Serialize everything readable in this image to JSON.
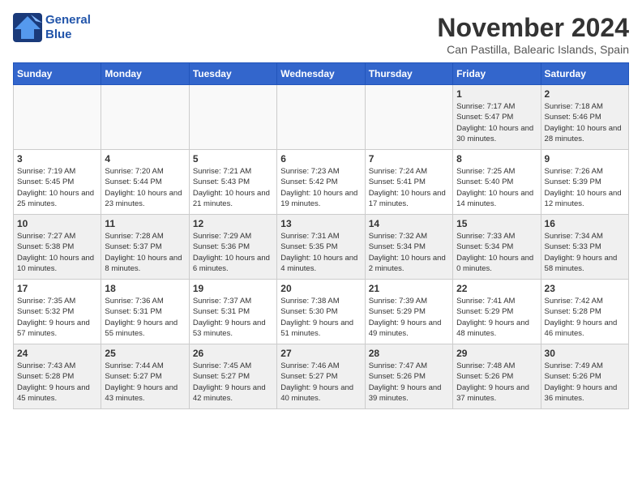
{
  "header": {
    "logo_line1": "General",
    "logo_line2": "Blue",
    "month_title": "November 2024",
    "location": "Can Pastilla, Balearic Islands, Spain"
  },
  "days_of_week": [
    "Sunday",
    "Monday",
    "Tuesday",
    "Wednesday",
    "Thursday",
    "Friday",
    "Saturday"
  ],
  "weeks": [
    [
      {
        "day": "",
        "info": "",
        "empty": true
      },
      {
        "day": "",
        "info": "",
        "empty": true
      },
      {
        "day": "",
        "info": "",
        "empty": true
      },
      {
        "day": "",
        "info": "",
        "empty": true
      },
      {
        "day": "",
        "info": "",
        "empty": true
      },
      {
        "day": "1",
        "info": "Sunrise: 7:17 AM\nSunset: 5:47 PM\nDaylight: 10 hours and 30 minutes."
      },
      {
        "day": "2",
        "info": "Sunrise: 7:18 AM\nSunset: 5:46 PM\nDaylight: 10 hours and 28 minutes."
      }
    ],
    [
      {
        "day": "3",
        "info": "Sunrise: 7:19 AM\nSunset: 5:45 PM\nDaylight: 10 hours and 25 minutes."
      },
      {
        "day": "4",
        "info": "Sunrise: 7:20 AM\nSunset: 5:44 PM\nDaylight: 10 hours and 23 minutes."
      },
      {
        "day": "5",
        "info": "Sunrise: 7:21 AM\nSunset: 5:43 PM\nDaylight: 10 hours and 21 minutes."
      },
      {
        "day": "6",
        "info": "Sunrise: 7:23 AM\nSunset: 5:42 PM\nDaylight: 10 hours and 19 minutes."
      },
      {
        "day": "7",
        "info": "Sunrise: 7:24 AM\nSunset: 5:41 PM\nDaylight: 10 hours and 17 minutes."
      },
      {
        "day": "8",
        "info": "Sunrise: 7:25 AM\nSunset: 5:40 PM\nDaylight: 10 hours and 14 minutes."
      },
      {
        "day": "9",
        "info": "Sunrise: 7:26 AM\nSunset: 5:39 PM\nDaylight: 10 hours and 12 minutes."
      }
    ],
    [
      {
        "day": "10",
        "info": "Sunrise: 7:27 AM\nSunset: 5:38 PM\nDaylight: 10 hours and 10 minutes."
      },
      {
        "day": "11",
        "info": "Sunrise: 7:28 AM\nSunset: 5:37 PM\nDaylight: 10 hours and 8 minutes."
      },
      {
        "day": "12",
        "info": "Sunrise: 7:29 AM\nSunset: 5:36 PM\nDaylight: 10 hours and 6 minutes."
      },
      {
        "day": "13",
        "info": "Sunrise: 7:31 AM\nSunset: 5:35 PM\nDaylight: 10 hours and 4 minutes."
      },
      {
        "day": "14",
        "info": "Sunrise: 7:32 AM\nSunset: 5:34 PM\nDaylight: 10 hours and 2 minutes."
      },
      {
        "day": "15",
        "info": "Sunrise: 7:33 AM\nSunset: 5:34 PM\nDaylight: 10 hours and 0 minutes."
      },
      {
        "day": "16",
        "info": "Sunrise: 7:34 AM\nSunset: 5:33 PM\nDaylight: 9 hours and 58 minutes."
      }
    ],
    [
      {
        "day": "17",
        "info": "Sunrise: 7:35 AM\nSunset: 5:32 PM\nDaylight: 9 hours and 57 minutes."
      },
      {
        "day": "18",
        "info": "Sunrise: 7:36 AM\nSunset: 5:31 PM\nDaylight: 9 hours and 55 minutes."
      },
      {
        "day": "19",
        "info": "Sunrise: 7:37 AM\nSunset: 5:31 PM\nDaylight: 9 hours and 53 minutes."
      },
      {
        "day": "20",
        "info": "Sunrise: 7:38 AM\nSunset: 5:30 PM\nDaylight: 9 hours and 51 minutes."
      },
      {
        "day": "21",
        "info": "Sunrise: 7:39 AM\nSunset: 5:29 PM\nDaylight: 9 hours and 49 minutes."
      },
      {
        "day": "22",
        "info": "Sunrise: 7:41 AM\nSunset: 5:29 PM\nDaylight: 9 hours and 48 minutes."
      },
      {
        "day": "23",
        "info": "Sunrise: 7:42 AM\nSunset: 5:28 PM\nDaylight: 9 hours and 46 minutes."
      }
    ],
    [
      {
        "day": "24",
        "info": "Sunrise: 7:43 AM\nSunset: 5:28 PM\nDaylight: 9 hours and 45 minutes."
      },
      {
        "day": "25",
        "info": "Sunrise: 7:44 AM\nSunset: 5:27 PM\nDaylight: 9 hours and 43 minutes."
      },
      {
        "day": "26",
        "info": "Sunrise: 7:45 AM\nSunset: 5:27 PM\nDaylight: 9 hours and 42 minutes."
      },
      {
        "day": "27",
        "info": "Sunrise: 7:46 AM\nSunset: 5:27 PM\nDaylight: 9 hours and 40 minutes."
      },
      {
        "day": "28",
        "info": "Sunrise: 7:47 AM\nSunset: 5:26 PM\nDaylight: 9 hours and 39 minutes."
      },
      {
        "day": "29",
        "info": "Sunrise: 7:48 AM\nSunset: 5:26 PM\nDaylight: 9 hours and 37 minutes."
      },
      {
        "day": "30",
        "info": "Sunrise: 7:49 AM\nSunset: 5:26 PM\nDaylight: 9 hours and 36 minutes."
      }
    ]
  ]
}
